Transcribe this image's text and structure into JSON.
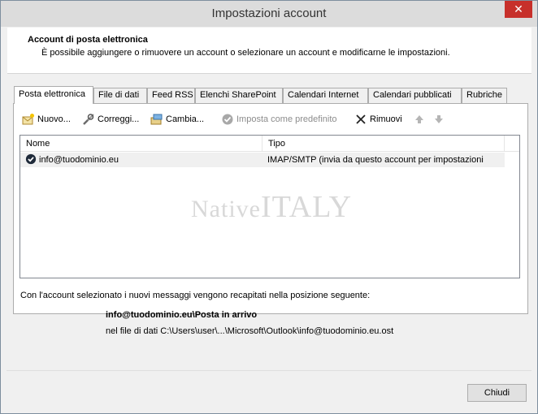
{
  "window": {
    "title": "Impostazioni account",
    "close_glyph": "✕"
  },
  "header": {
    "title": "Account di posta elettronica",
    "description": "È possibile aggiungere o rimuovere un account o selezionare un account e modificarne le impostazioni."
  },
  "tabs": [
    {
      "label": "Posta elettronica"
    },
    {
      "label": "File di dati"
    },
    {
      "label": "Feed RSS"
    },
    {
      "label": "Elenchi SharePoint"
    },
    {
      "label": "Calendari Internet"
    },
    {
      "label": "Calendari pubblicati"
    },
    {
      "label": "Rubriche"
    }
  ],
  "toolbar": {
    "new_label": "Nuovo...",
    "repair_label": "Correggi...",
    "change_label": "Cambia...",
    "default_label": "Imposta come predefinito",
    "remove_label": "Rimuovi"
  },
  "list": {
    "columns": {
      "name": "Nome",
      "type": "Tipo"
    },
    "rows": [
      {
        "name": "info@tuodominio.eu",
        "type": "IMAP/SMTP (invia da questo account per impostazioni"
      }
    ]
  },
  "watermark": {
    "part1": "Native",
    "part2": "ITALY"
  },
  "info": {
    "text": "Con l'account selezionato i nuovi messaggi vengono recapitati nella posizione seguente:",
    "destination": "info@tuodominio.eu\\Posta in arrivo",
    "data_file": "nel file di dati C:\\Users\\user\\...\\Microsoft\\Outlook\\info@tuodominio.eu.ost"
  },
  "footer": {
    "close_label": "Chiudi"
  },
  "colors": {
    "close_red": "#c7302b",
    "selection": "#f0f0f0"
  }
}
